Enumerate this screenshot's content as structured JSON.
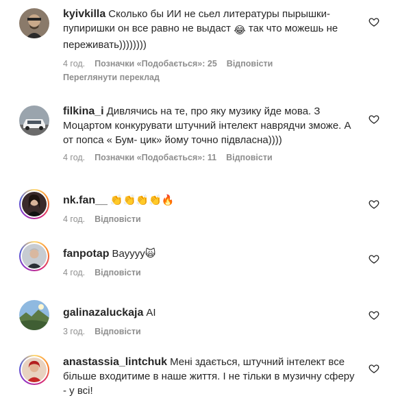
{
  "comments": [
    {
      "username": "kyivkilla",
      "text": "Сколько бы ИИ не сьел литературы пырышки-пупиришки он все равно не выдаст",
      "emoji": "😂",
      "text_after": " так что можешь не переживать))))))))",
      "time": "4 год.",
      "likes": "Позначки «Подобається»: 25",
      "reply": "Відповісти",
      "translate": "Переглянути переклад"
    },
    {
      "username": "filkina_i",
      "text": "Дивлячись на те, про яку музику йде мова. З Моцартом конкурувати штучний інтелект наврядчи зможе. А от попса « Бум- цик» йому точно підвласна))))",
      "time": "4 год.",
      "likes": "Позначки «Подобається»: 11",
      "reply": "Відповісти"
    },
    {
      "username": "nk.fan__",
      "text": "👏👏👏👏🔥",
      "time": "4 год.",
      "reply": "Відповісти"
    },
    {
      "username": "fanpotap",
      "text": "Вауууу",
      "emoji": "🙀",
      "time": "4 год.",
      "reply": "Відповісти"
    },
    {
      "username": "galinazaluckaja",
      "text": "AI",
      "time": "3 год.",
      "reply": "Відповісти"
    },
    {
      "username": "anastassia_lintchuk",
      "text": "Мені здається, штучний інтелект все більше входитиме в наше життя. І не тільки в музичну сферу - у всі!"
    }
  ],
  "colors": {
    "text": "#262626",
    "muted": "#8e8e8e"
  }
}
